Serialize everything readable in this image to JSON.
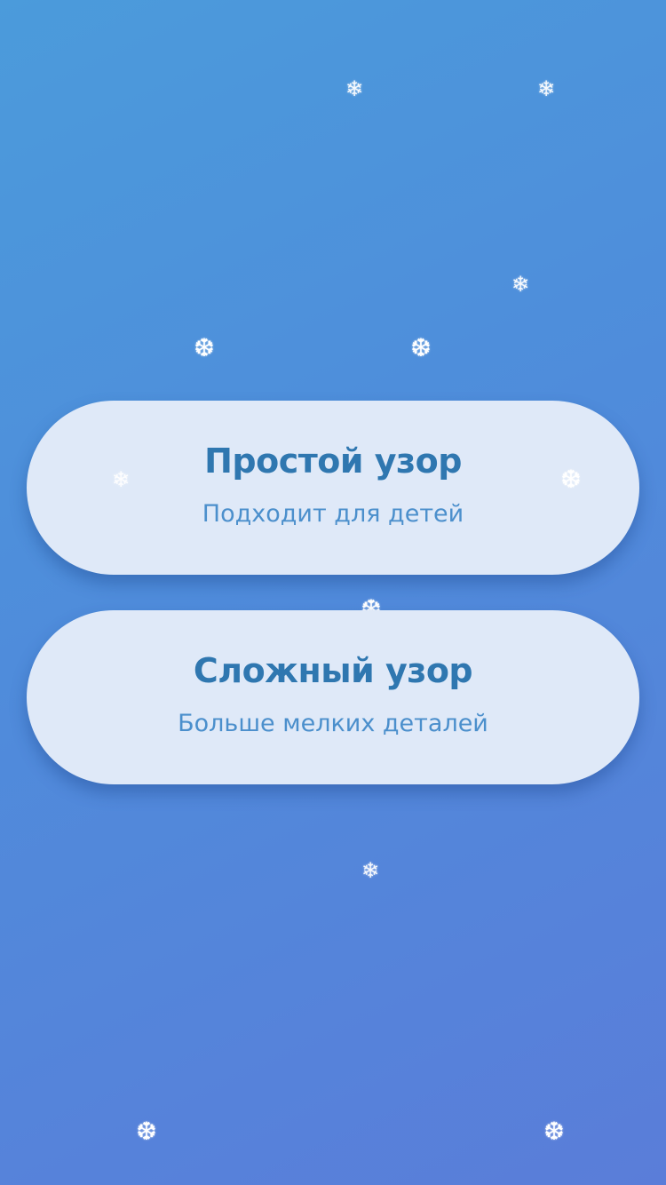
{
  "options": [
    {
      "title": "Простой узор",
      "subtitle": "Подходит для детей"
    },
    {
      "title": "Сложный узор",
      "subtitle": "Больше мелких деталей"
    }
  ],
  "snowflake_glyphs": {
    "thin": "❄",
    "bold": "❆"
  },
  "colors": {
    "background_start": "#4b9bdb",
    "background_end": "#5a7dd9",
    "card_background": "#dfe9f8",
    "title": "#2f77b0",
    "subtitle": "#4b8fcc",
    "snowflake": "#ffffff"
  }
}
